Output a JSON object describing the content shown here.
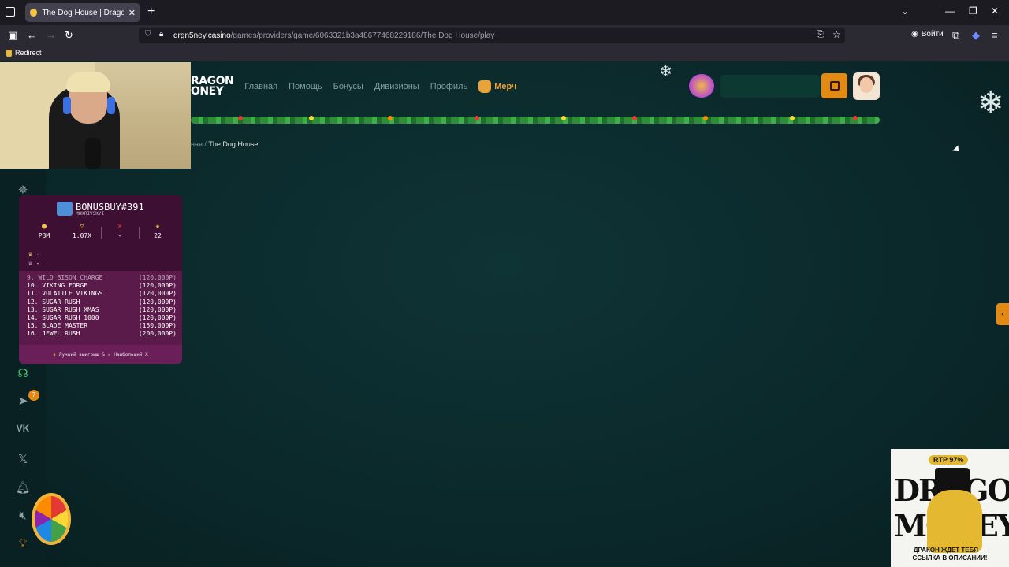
{
  "browser": {
    "tab_title": "The Dog House | Dragon Mone",
    "url_domain": "drgn5ney.casino",
    "url_path": "/games/providers/game/6063321b3a48677468229186/The Dog House/play",
    "signin_label": "Войти",
    "bookmark_label": "Redirect"
  },
  "site": {
    "logo_line1": "RAGON",
    "logo_line2": "ONEY",
    "nav": [
      "Главная",
      "Помощь",
      "Бонусы",
      "Дивизионы",
      "Профиль"
    ],
    "merch_label": "Мерч",
    "breadcrumb_prev": "ная",
    "breadcrumb_current": "The Dog House"
  },
  "bonus_panel": {
    "title": "BONUSBUY#391",
    "subtitle": "MOKRIVSKYI",
    "stats": [
      {
        "icon": "coin-icon",
        "value": "P3M"
      },
      {
        "icon": "scale-icon",
        "value": "1.07X"
      },
      {
        "icon": "cross-icon",
        "value": "-"
      },
      {
        "icon": "star-icon",
        "value": "22"
      }
    ],
    "crown_rows": [
      "-",
      "-"
    ],
    "list": [
      {
        "name": "9.  WILD BISON CHARGE",
        "price": "(120,000P)"
      },
      {
        "name": "10. VIKING FORGE",
        "price": "(120,000P)"
      },
      {
        "name": "11. VOLATILE VIKINGS",
        "price": "(120,000P)"
      },
      {
        "name": "12. SUGAR RUSH",
        "price": "(120,000P)"
      },
      {
        "name": "13. SUGAR RUSH XMAS",
        "price": "(120,000P)"
      },
      {
        "name": "14. SUGAR RUSH 1000",
        "price": "(120,000P)"
      },
      {
        "name": "15. BLADE MASTER",
        "price": "(150,000P)"
      },
      {
        "name": "16. JEWEL RUSH",
        "price": "(200,000P)"
      }
    ],
    "footer_best": "Лучший выигрыш &",
    "footer_max": "Наибольший X"
  },
  "promo": {
    "rtp": "RTP 97%",
    "graffiti": "DRAGON MONEY",
    "bottom_line1": "ДРАКОН ЖДЕТ ТЕБЯ —",
    "bottom_line2": "ССЫЛКА В ОПИСАНИИ!"
  },
  "sidebar": {
    "telegram_badge": "7"
  }
}
